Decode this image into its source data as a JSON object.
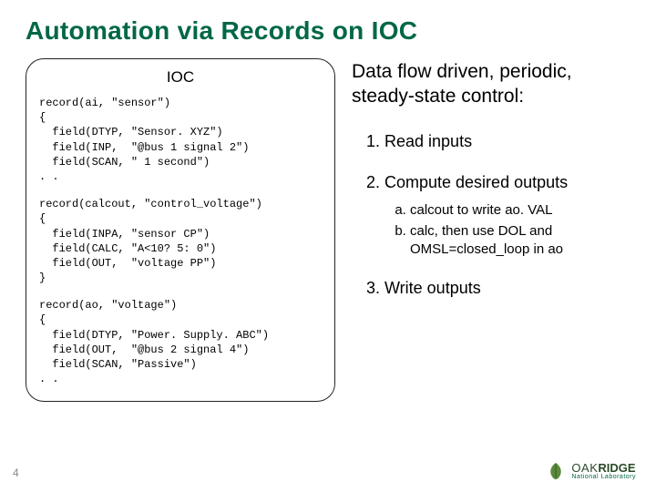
{
  "title": "Automation via Records on IOC",
  "ioc": {
    "label": "IOC",
    "block1": "record(ai, \"sensor\")\n{\n  field(DTYP, \"Sensor. XYZ\")\n  field(INP,  \"@bus 1 signal 2\")\n  field(SCAN, \" 1 second\")\n. .",
    "block2": "record(calcout, \"control_voltage\")\n{\n  field(INPA, \"sensor CP\")\n  field(CALC, \"A<10? 5: 0\")\n  field(OUT,  \"voltage PP\")\n}",
    "block3": "record(ao, \"voltage\")\n{\n  field(DTYP, \"Power. Supply. ABC\")\n  field(OUT,  \"@bus 2 signal 4\")\n  field(SCAN, \"Passive\")\n. ."
  },
  "right": {
    "headline": "Data flow driven, periodic,\nsteady-state control:",
    "items": {
      "i1": "Read inputs",
      "i2": "Compute desired outputs",
      "i2a": "calcout to write ao. VAL",
      "i2b": "calc, then use DOL and OMSL=closed_loop in ao",
      "i3": "Write outputs"
    }
  },
  "page_num": "4",
  "logo": {
    "oak": "OAK",
    "ridge": "RIDGE",
    "sub": "National Laboratory"
  }
}
